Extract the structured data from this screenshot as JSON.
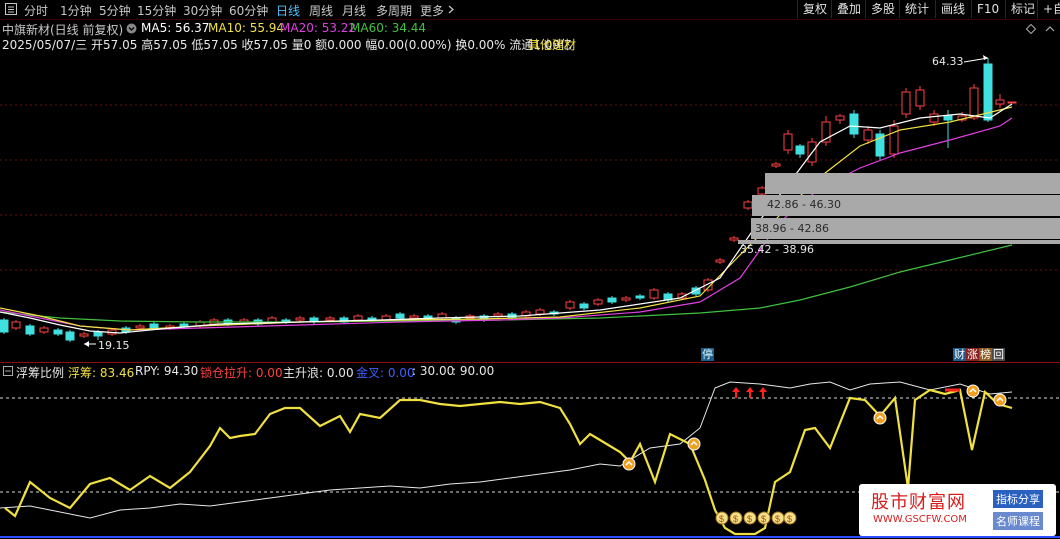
{
  "toolbar": {
    "menu_icon": "menu-box-icon",
    "periods": [
      "分时",
      "1分钟",
      "5分钟",
      "15分钟",
      "30分钟",
      "60分钟",
      "日线",
      "周线",
      "月线",
      "多周期",
      "更多"
    ],
    "active_period": "日线",
    "more_chevron": "chevron-right-icon",
    "right_buttons": [
      "复权",
      "叠加",
      "多股",
      "统计",
      "画线",
      "F10",
      "标记",
      "+自"
    ]
  },
  "header": {
    "title": "中旗新材(日线 前复权)",
    "ma5": "MA5: 56.37",
    "ma10": "MA10: 55.94",
    "ma20": "MA20: 53.22",
    "ma60": "MA60: 34.44",
    "quote": "2025/05/07/三 开57.05 高57.05 低57.05 收57.05 量0 额0.000 幅0.00(0.00%) 换0.00% 流通1.09亿",
    "sector": "其他建材"
  },
  "colors": {
    "ma5": "#ffffff",
    "ma10": "#f0e040",
    "ma20": "#e040e0",
    "ma60": "#40c040",
    "up": "#ff4040",
    "down": "#40e0e0",
    "accent": "#4fc3ff",
    "indicator": "#f0e040"
  },
  "chart": {
    "high_label": "64.33",
    "low_label": "19.15",
    "zones": [
      "42.86 - 46.30",
      "38.96 - 42.86",
      "35.42 - 38.96"
    ],
    "tag_stop": "停",
    "tag_cai": "财",
    "tag_zhang": "涨",
    "tag_bang": "榜",
    "tag_hui": "回"
  },
  "indicator": {
    "name": "浮筹比例",
    "fuchou": "浮筹: 83.46",
    "rpy": "RPY: 94.30",
    "suocang": "锁仓拉升: 0.00",
    "zhushenglang": "主升浪: 0.00",
    "jincha": "金叉: 0.00",
    "v30": ": 30.00",
    "v90": ": 90.00"
  },
  "chart_data": {
    "type": "candlestick",
    "title": "中旗新材(日线 前复权)",
    "price_labels": {
      "high": 64.33,
      "low": 19.15
    },
    "resistance_zones": [
      [
        42.86,
        46.3
      ],
      [
        38.96,
        42.86
      ],
      [
        35.42,
        38.96
      ]
    ],
    "last": {
      "open": 57.05,
      "high": 57.05,
      "low": 57.05,
      "close": 57.05
    },
    "ma": {
      "MA5": 56.37,
      "MA10": 55.94,
      "MA20": 53.22,
      "MA60": 34.44
    },
    "indicator_lines": {
      "fuchou": 83.46,
      "rpy": 94.3,
      "level_high": 90.0,
      "level_low": 30.0
    }
  },
  "watermark": {
    "brand": "股市财富网",
    "url": "WWW.GSCFW.COM",
    "tag1": "指标分享",
    "tag2": "名师课程"
  }
}
